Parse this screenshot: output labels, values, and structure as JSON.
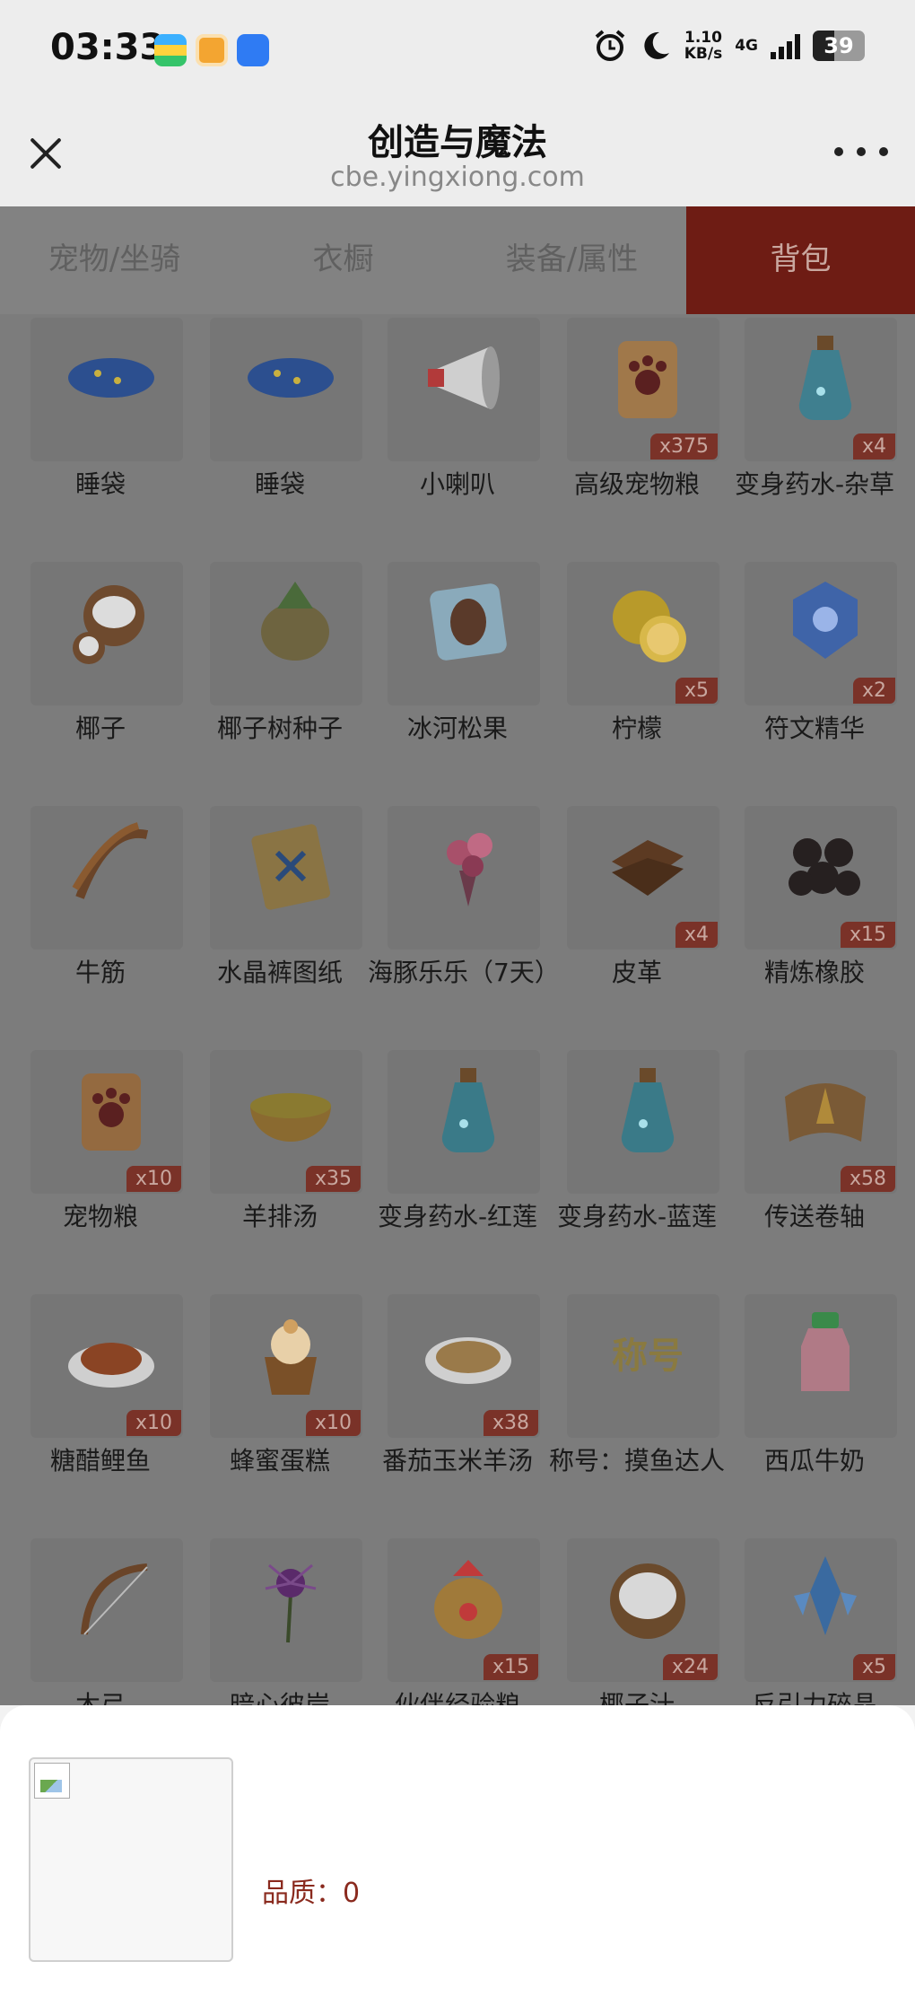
{
  "status_bar": {
    "time": "03:33",
    "speed_value": "1.10",
    "speed_unit": "KB/s",
    "network": "4G",
    "battery": "39"
  },
  "titlebar": {
    "title": "创造与魔法",
    "url": "cbe.yingxiong.com"
  },
  "tabs": [
    "宠物/坐骑",
    "衣橱",
    "装备/属性",
    "背包"
  ],
  "active_tab": "背包",
  "items": [
    [
      {
        "name": "睡袋",
        "qty": "",
        "icon": "sleeping-bag-icon",
        "color": "#2c4f8f"
      },
      {
        "name": "睡袋",
        "qty": "",
        "icon": "sleeping-bag-icon",
        "color": "#2c4f8f"
      },
      {
        "name": "小喇叭",
        "qty": "",
        "icon": "megaphone-icon",
        "color": "#b23a3a"
      },
      {
        "name": "高级宠物粮",
        "qty": "x375",
        "icon": "pet-food-bag-icon",
        "color": "#a0784a"
      },
      {
        "name": "变身药水-杂草",
        "qty": "x4",
        "icon": "potion-icon",
        "color": "#3f7f8f"
      }
    ],
    [
      {
        "name": "椰子",
        "qty": "",
        "icon": "coconut-icon",
        "color": "#6e4a2e"
      },
      {
        "name": "椰子树种子",
        "qty": "",
        "icon": "seed-sack-icon",
        "color": "#6e6440"
      },
      {
        "name": "冰河松果",
        "qty": "",
        "icon": "ice-pinecone-icon",
        "color": "#6a8aa0"
      },
      {
        "name": "柠檬",
        "qty": "x5",
        "icon": "lemon-icon",
        "color": "#b89a2a"
      },
      {
        "name": "符文精华",
        "qty": "x2",
        "icon": "rune-essence-icon",
        "color": "#3f64a8"
      }
    ],
    [
      {
        "name": "牛筋",
        "qty": "",
        "icon": "sinew-icon",
        "color": "#6a4428"
      },
      {
        "name": "水晶裤图纸",
        "qty": "",
        "icon": "blueprint-scroll-icon",
        "color": "#8a7444"
      },
      {
        "name": "海豚乐乐（7天）",
        "qty": "",
        "icon": "bouquet-icon",
        "color": "#a8506a"
      },
      {
        "name": "皮革",
        "qty": "x4",
        "icon": "leather-icon",
        "color": "#5c3a22"
      },
      {
        "name": "精炼橡胶",
        "qty": "x15",
        "icon": "rubber-icon",
        "color": "#262020"
      }
    ],
    [
      {
        "name": "宠物粮",
        "qty": "x10",
        "icon": "pet-food-bag-icon",
        "color": "#946a40"
      },
      {
        "name": "羊排汤",
        "qty": "x35",
        "icon": "soup-bowl-icon",
        "color": "#8a6a30"
      },
      {
        "name": "变身药水-红莲",
        "qty": "",
        "icon": "potion-icon",
        "color": "#3a7a88"
      },
      {
        "name": "变身药水-蓝莲",
        "qty": "",
        "icon": "potion-icon",
        "color": "#3a7a88"
      },
      {
        "name": "传送卷轴",
        "qty": "x58",
        "icon": "teleport-scroll-icon",
        "color": "#7a5a36"
      }
    ],
    [
      {
        "name": "糖醋鲤鱼",
        "qty": "x10",
        "icon": "fish-dish-icon",
        "color": "#8a4424"
      },
      {
        "name": "蜂蜜蛋糕",
        "qty": "x10",
        "icon": "cupcake-icon",
        "color": "#7a5028"
      },
      {
        "name": "番茄玉米羊汤",
        "qty": "x38",
        "icon": "soup-plate-icon",
        "color": "#9a7a4a"
      },
      {
        "name": "称号：摸鱼达人",
        "qty": "",
        "icon": "title-badge-icon",
        "color": "#8a7a40"
      },
      {
        "name": "西瓜牛奶",
        "qty": "",
        "icon": "milk-bottle-icon",
        "color": "#b07a86"
      }
    ],
    [
      {
        "name": "木弓",
        "qty": "",
        "icon": "bow-icon",
        "color": "#6a4428"
      },
      {
        "name": "暗心彼岸",
        "qty": "",
        "icon": "spider-lily-icon",
        "color": "#5a2a6a"
      },
      {
        "name": "伙伴经验粮",
        "qty": "x15",
        "icon": "treasure-bag-icon",
        "color": "#a07a3a"
      },
      {
        "name": "椰子汁",
        "qty": "x24",
        "icon": "coconut-drink-icon",
        "color": "#6a4a2c"
      },
      {
        "name": "反引力碎晶",
        "qty": "x5",
        "icon": "crystal-shard-icon",
        "color": "#3a6aa0"
      }
    ]
  ],
  "sheet": {
    "quality_label": "品质：0"
  }
}
